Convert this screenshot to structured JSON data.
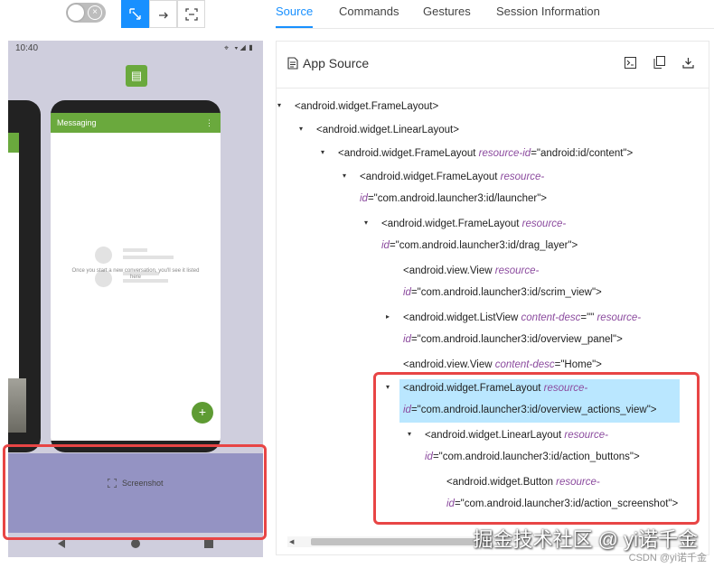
{
  "toolbar": {
    "toggle_icon": "close-circle-icon",
    "tools": [
      "select-icon",
      "swipe-icon",
      "tap-crosshair-icon"
    ]
  },
  "tabs": [
    "Source",
    "Commands",
    "Gestures",
    "Session Information"
  ],
  "active_tab": "Source",
  "device": {
    "time": "10:40",
    "status_icons": "⌖ ▾◢▮",
    "card_title": "Messaging",
    "empty_text": "Once you start a new conversation, you'll see it listed here",
    "screenshot_label": "Screenshot",
    "fab_label": "+"
  },
  "source_panel": {
    "title": "App Source",
    "actions": [
      "terminal-icon",
      "copy-icon",
      "download-icon"
    ]
  },
  "tree": [
    {
      "caret": "▾",
      "tag": "<android.widget.FrameLayout>",
      "attr": "",
      "val": "",
      "cont": ""
    },
    {
      "caret": "▾",
      "tag": "<android.widget.LinearLayout>",
      "attr": "",
      "val": "",
      "cont": ""
    },
    {
      "caret": "▾",
      "tag": "<android.widget.FrameLayout ",
      "attr": "resource-id",
      "val": "=\"android:id/content\">",
      "cont": ""
    },
    {
      "caret": "▾",
      "tag": "<android.widget.FrameLayout ",
      "attr": "resource-",
      "val": "",
      "cont_attr": "id",
      "cont": "=\"com.android.launcher3:id/launcher\">"
    },
    {
      "caret": "▾",
      "tag": "<android.widget.FrameLayout ",
      "attr": "resource-",
      "val": "",
      "cont_attr": "id",
      "cont": "=\"com.android.launcher3:id/drag_layer\">"
    },
    {
      "caret": "",
      "tag": "<android.view.View ",
      "attr": "resource-",
      "val": "",
      "cont_attr": "id",
      "cont": "=\"com.android.launcher3:id/scrim_view\">"
    },
    {
      "caret": "▸",
      "tag": "<android.widget.ListView ",
      "attr": "content-desc",
      "val": "=\"\" ",
      "attr2": "resource-",
      "cont_attr": "id",
      "cont": "=\"com.android.launcher3:id/overview_panel\">"
    },
    {
      "caret": "",
      "tag": "<android.view.View ",
      "attr": "content-desc",
      "val": "=\"Home\">",
      "cont": ""
    },
    {
      "caret": "▾",
      "tag": "<android.widget.FrameLayout ",
      "attr": "resource-",
      "val": "",
      "cont_attr": "id",
      "cont": "=\"com.android.launcher3:id/overview_actions_view\">"
    },
    {
      "caret": "▾",
      "tag": "<android.widget.LinearLayout ",
      "attr": "resource-",
      "val": "",
      "cont_attr": "id",
      "cont": "=\"com.android.launcher3:id/action_buttons\">"
    },
    {
      "caret": "",
      "tag": "<android.widget.Button ",
      "attr": "resource-",
      "val": "",
      "cont_attr": "id",
      "cont": "=\"com.android.launcher3:id/action_screenshot\">"
    }
  ],
  "watermark": "掘金技术社区 @ yi诺千金",
  "watermark_small": "CSDN @yi诺千金",
  "colors": {
    "accent": "#1890ff",
    "highlight": "#bae7ff",
    "attr": "#8b4a9e",
    "annotation": "#e84545",
    "app_green": "#6aa93d",
    "screenshot_bar": "#9493c3"
  }
}
